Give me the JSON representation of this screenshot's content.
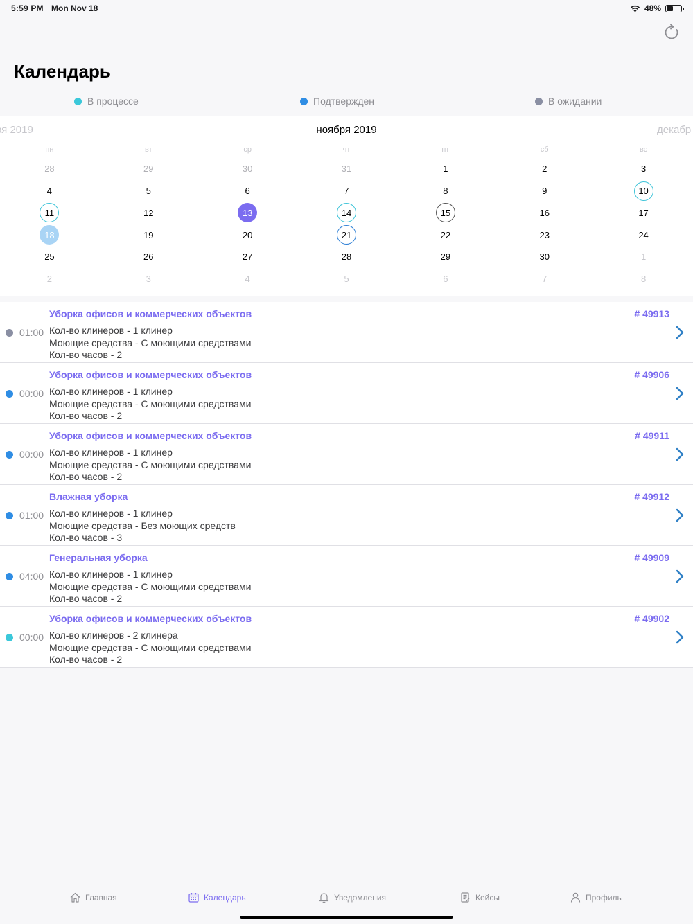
{
  "status_bar": {
    "time": "5:59 PM",
    "date": "Mon Nov 18",
    "battery_text": "48%",
    "battery_level": 0.48
  },
  "header": {
    "title": "Календарь",
    "refresh_icon": "refresh-icon"
  },
  "legend": [
    {
      "label": "В процессе",
      "color": "#3bc8da"
    },
    {
      "label": "Подтвержден",
      "color": "#2f8de4"
    },
    {
      "label": "В ожидании",
      "color": "#8a8fa3"
    }
  ],
  "calendar": {
    "prev_month": "ря 2019",
    "current_month": "ноября 2019",
    "next_month": "декабр",
    "weekdays": [
      "пн",
      "вт",
      "ср",
      "чт",
      "пт",
      "сб",
      "вс"
    ],
    "days": [
      {
        "d": "28",
        "s": "outside"
      },
      {
        "d": "29",
        "s": "outside"
      },
      {
        "d": "30",
        "s": "outside"
      },
      {
        "d": "31",
        "s": "outside"
      },
      {
        "d": "1",
        "s": ""
      },
      {
        "d": "2",
        "s": ""
      },
      {
        "d": "3",
        "s": ""
      },
      {
        "d": "4",
        "s": ""
      },
      {
        "d": "5",
        "s": ""
      },
      {
        "d": "6",
        "s": ""
      },
      {
        "d": "7",
        "s": ""
      },
      {
        "d": "8",
        "s": ""
      },
      {
        "d": "9",
        "s": ""
      },
      {
        "d": "10",
        "s": "ring-cyan"
      },
      {
        "d": "11",
        "s": "ring-cyan"
      },
      {
        "d": "12",
        "s": ""
      },
      {
        "d": "13",
        "s": "selected"
      },
      {
        "d": "14",
        "s": "ring-cyan"
      },
      {
        "d": "15",
        "s": "ring-gray"
      },
      {
        "d": "16",
        "s": ""
      },
      {
        "d": "17",
        "s": ""
      },
      {
        "d": "18",
        "s": "today"
      },
      {
        "d": "19",
        "s": ""
      },
      {
        "d": "20",
        "s": ""
      },
      {
        "d": "21",
        "s": "ring-blue"
      },
      {
        "d": "22",
        "s": ""
      },
      {
        "d": "23",
        "s": ""
      },
      {
        "d": "24",
        "s": ""
      },
      {
        "d": "25",
        "s": ""
      },
      {
        "d": "26",
        "s": ""
      },
      {
        "d": "27",
        "s": ""
      },
      {
        "d": "28",
        "s": ""
      },
      {
        "d": "29",
        "s": ""
      },
      {
        "d": "30",
        "s": ""
      },
      {
        "d": "1",
        "s": "muted"
      },
      {
        "d": "2",
        "s": "muted"
      },
      {
        "d": "3",
        "s": "muted"
      },
      {
        "d": "4",
        "s": "muted"
      },
      {
        "d": "5",
        "s": "muted"
      },
      {
        "d": "6",
        "s": "muted"
      },
      {
        "d": "7",
        "s": "muted"
      },
      {
        "d": "8",
        "s": "muted"
      }
    ]
  },
  "orders": [
    {
      "title": "Уборка офисов и коммерческих объектов",
      "number": "# 49913",
      "time": "01:00",
      "status_color": "#8a8fa3",
      "line1": "Кол-во клинеров - 1 клинер",
      "line2": "Моющие средства - С моющими средствами",
      "line3": "Кол-во часов - 2"
    },
    {
      "title": "Уборка офисов и коммерческих объектов",
      "number": "# 49906",
      "time": "00:00",
      "status_color": "#2f8de4",
      "line1": "Кол-во клинеров - 1 клинер",
      "line2": "Моющие средства - С моющими средствами",
      "line3": "Кол-во часов - 2"
    },
    {
      "title": "Уборка офисов и коммерческих объектов",
      "number": "# 49911",
      "time": "00:00",
      "status_color": "#2f8de4",
      "line1": "Кол-во клинеров - 1 клинер",
      "line2": "Моющие средства - С моющими средствами",
      "line3": "Кол-во часов - 2"
    },
    {
      "title": "Влажная уборка",
      "number": "# 49912",
      "time": "01:00",
      "status_color": "#2f8de4",
      "line1": "Кол-во клинеров - 1 клинер",
      "line2": "Моющие средства - Без моющих средств",
      "line3": "Кол-во часов - 3"
    },
    {
      "title": "Генеральная уборка",
      "number": "# 49909",
      "time": "04:00",
      "status_color": "#2f8de4",
      "line1": "Кол-во клинеров - 1 клинер",
      "line2": "Моющие средства - С моющими средствами",
      "line3": "Кол-во часов - 2"
    },
    {
      "title": "Уборка офисов и коммерческих объектов",
      "number": "# 49902",
      "time": "00:00",
      "status_color": "#3bc8da",
      "line1": "Кол-во клинеров - 2 клинера",
      "line2": "Моющие средства - С моющими средствами",
      "line3": "Кол-во часов - 2"
    }
  ],
  "tabbar": [
    {
      "label": "Главная",
      "icon": "home-icon",
      "active": false
    },
    {
      "label": "Календарь",
      "icon": "calendar-icon",
      "active": true
    },
    {
      "label": "Уведомления",
      "icon": "bell-icon",
      "active": false
    },
    {
      "label": "Кейсы",
      "icon": "document-icon",
      "active": false
    },
    {
      "label": "Профиль",
      "icon": "person-icon",
      "active": false
    }
  ],
  "colors": {
    "accent": "#7b6cf0",
    "chevron": "#2f80c6"
  }
}
